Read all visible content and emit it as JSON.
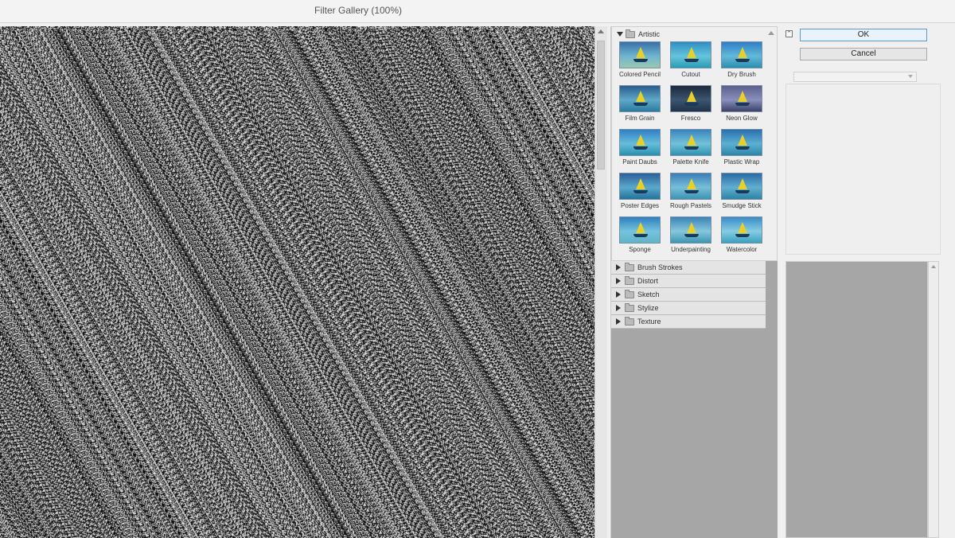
{
  "window": {
    "title": "Filter Gallery (100%)"
  },
  "filters": {
    "expanded_category": "Artistic",
    "items": [
      {
        "label": "Colored Pencil"
      },
      {
        "label": "Cutout"
      },
      {
        "label": "Dry Brush"
      },
      {
        "label": "Film Grain"
      },
      {
        "label": "Fresco"
      },
      {
        "label": "Neon Glow"
      },
      {
        "label": "Paint Daubs"
      },
      {
        "label": "Palette Knife"
      },
      {
        "label": "Plastic Wrap"
      },
      {
        "label": "Poster Edges"
      },
      {
        "label": "Rough Pastels"
      },
      {
        "label": "Smudge Stick"
      },
      {
        "label": "Sponge"
      },
      {
        "label": "Underpainting"
      },
      {
        "label": "Watercolor"
      }
    ],
    "collapsed_categories": [
      {
        "label": "Brush Strokes"
      },
      {
        "label": "Distort"
      },
      {
        "label": "Sketch"
      },
      {
        "label": "Stylize"
      },
      {
        "label": "Texture"
      }
    ]
  },
  "actions": {
    "ok_label": "OK",
    "cancel_label": "Cancel"
  },
  "colors": {
    "preview_bg": "#2a2a2a",
    "panel_gray": "#a6a6a6",
    "ok_border": "#5b9bd5"
  }
}
